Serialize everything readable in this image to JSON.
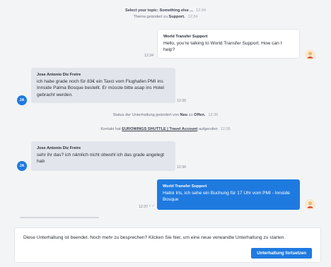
{
  "system": {
    "topic_prefix": "Select your topic: Something else ...",
    "topic_time": "12:34",
    "theme_prefix": "Thema geändert zu",
    "theme_value": "Support.",
    "theme_time": "12:34",
    "status_prefix": "Status der Unterhaltung geändert von",
    "status_from": "Neu",
    "status_mid": "zu",
    "status_to": "Offen.",
    "status_time": "12:35",
    "contact_prefix": "Kontakt hat",
    "contact_link": "EUROWINGS SHUTTLE | Travel Account",
    "contact_suffix": "aufgerufen",
    "contact_time": "12:35"
  },
  "messages": [
    {
      "sender": "World Transfer Support",
      "text": "Hello, you're talking to World Transfer Support. How can I help?",
      "time": "12:34",
      "side": "out",
      "avatar": "bot-avatar"
    },
    {
      "sender": "Jose Antonio Diz Freire",
      "text": "ich habe grade noch für 83€ ein Taxci vom Flughafen PMI ins Innside Palma Bosque bestellt. Er müsste bitte asap ins Hotel gebracht werden.",
      "time": "12:35",
      "side": "in",
      "avatar": "JA"
    },
    {
      "sender": "Jose Antonio Diz Freire",
      "text": "sehr ihr das? ich nämlich nicht obwohl ich das grade angelegt hab",
      "time": "12:36",
      "side": "in",
      "avatar": "JA"
    },
    {
      "sender": "World Transfer Support",
      "text": "Halloi Iris, ich sehe ein Buchung für 17 Uhr vom PMI - Innside Bosque",
      "time": "12:37",
      "side": "out-blue",
      "avatar": "bot-avatar"
    }
  ],
  "footer": {
    "text": "Diese Unterhaltung ist beendet. Noch mehr zu besprechen? Klicken Sie hier, um eine neue verwandte Unterhaltung zu starten.",
    "button": "Unterhaltung fortsetzen"
  },
  "colors": {
    "accent": "#1f7ae0",
    "incoming_bubble": "#e3e5ec",
    "background": "#f3f4f6"
  }
}
